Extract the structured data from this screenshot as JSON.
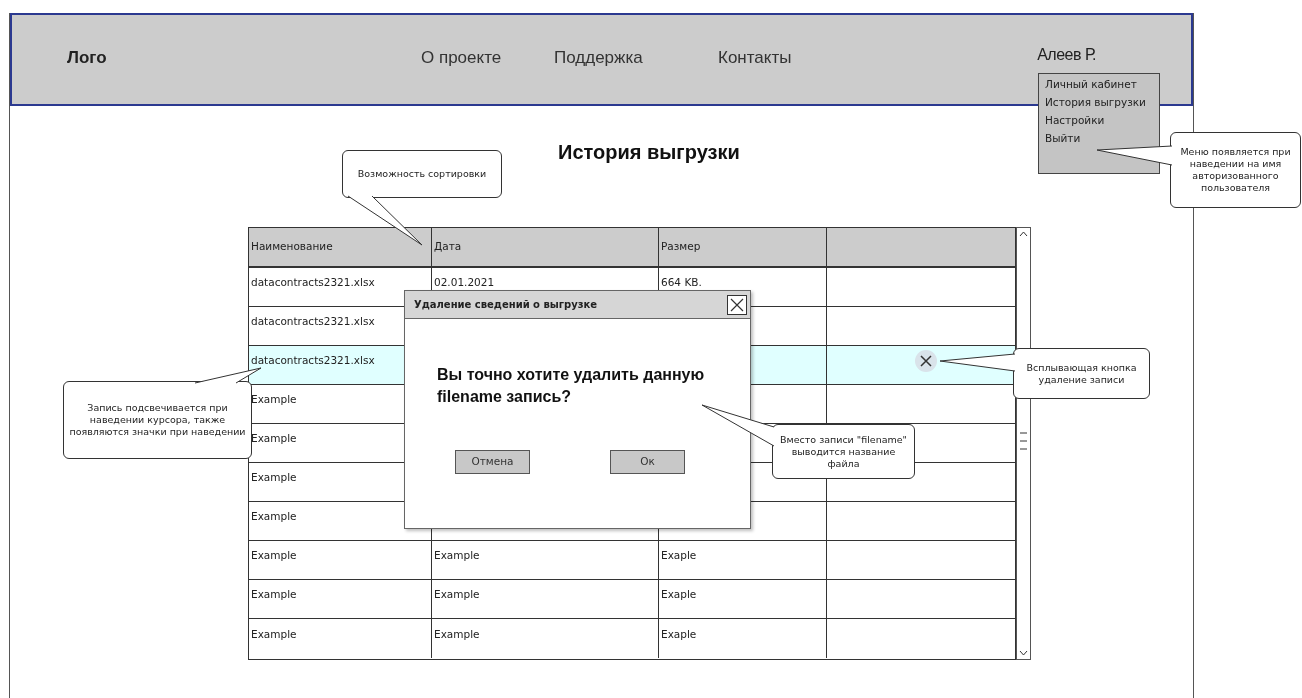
{
  "header": {
    "logo": "Лого",
    "nav": [
      "О проекте",
      "Поддержка",
      "Контакты"
    ],
    "user": "Алеев Р.",
    "user_menu": [
      "Личный кабинет",
      "История выгрузки",
      "Настройки",
      "Выйти"
    ]
  },
  "title": "История выгрузки",
  "table": {
    "columns": [
      "Наименование",
      "Дата",
      "Размер"
    ],
    "rows": [
      {
        "cells": [
          "datacontracts2321.xlsx",
          "02.01.2021",
          "664 KB."
        ],
        "highlighted": false
      },
      {
        "cells": [
          "datacontracts2321.xlsx"
        ],
        "highlighted": false
      },
      {
        "cells": [
          "datacontracts2321.xlsx"
        ],
        "highlighted": true
      },
      {
        "cells": [
          "Example"
        ],
        "highlighted": false
      },
      {
        "cells": [
          "Example"
        ],
        "highlighted": false
      },
      {
        "cells": [
          "Example"
        ],
        "highlighted": false
      },
      {
        "cells": [
          "Example"
        ],
        "highlighted": false
      },
      {
        "cells": [
          "Example",
          "Example",
          "Exaple"
        ],
        "highlighted": false
      },
      {
        "cells": [
          "Example",
          "Example",
          "Exaple"
        ],
        "highlighted": false
      },
      {
        "cells": [
          "Example",
          "Example",
          "Exaple"
        ],
        "highlighted": false
      }
    ]
  },
  "dialog": {
    "title": "Удаление сведений о выгрузке",
    "message": "Вы точно хотите удалить данную filename запись?",
    "buttons": [
      "Отмена",
      "Ок"
    ]
  },
  "callouts": [
    "Возможность сортировки",
    "Меню появляется при наведении на имя авторизованного пользователя",
    "Запись подсвечивается при наведении курсора, также появляются значки при наведении",
    "Всплывающая кнопка удаление записи",
    "Вместо записи \"filename\" выводится название файла"
  ]
}
